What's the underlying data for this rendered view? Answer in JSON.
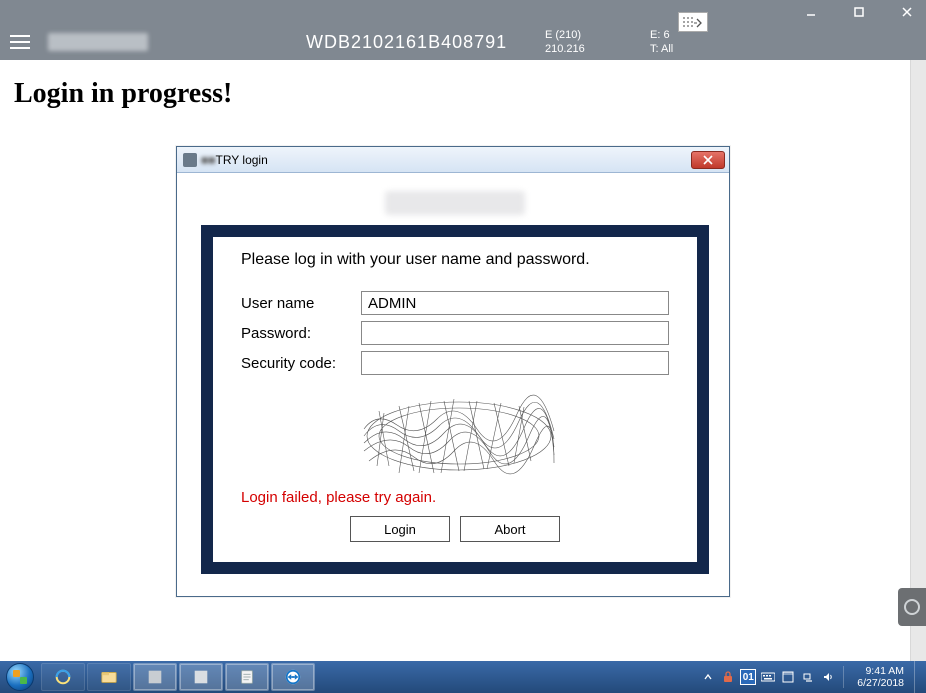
{
  "window": {
    "min_tip": "Minimize",
    "max_tip": "Maximize",
    "close_tip": "Close"
  },
  "header": {
    "vin": "WDB2102161B408791",
    "col1_line1": "E (210)",
    "col1_line2": "210.216",
    "col2_line1": "E: 6",
    "col2_line2": "T: All"
  },
  "page": {
    "heading": "Login in progress!"
  },
  "dialog": {
    "title_obscured": "■■",
    "title_suffix": "TRY login",
    "instruction": "Please log in with your user name and password.",
    "labels": {
      "username": "User name",
      "password": "Password:",
      "security": "Security code:"
    },
    "values": {
      "username": "ADMIN",
      "password": "",
      "security": ""
    },
    "error": "Login failed, please try again.",
    "buttons": {
      "login": "Login",
      "abort": "Abort"
    }
  },
  "taskbar": {
    "clock_time": "9:41 AM",
    "clock_date": "6/27/2018",
    "tray_badge": "01"
  }
}
